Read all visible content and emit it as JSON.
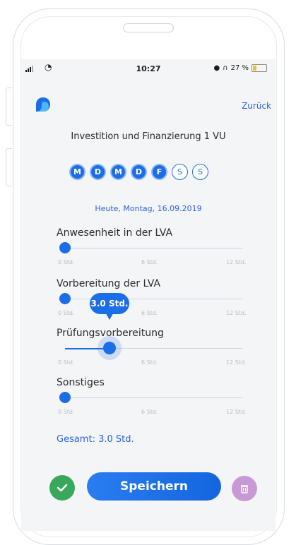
{
  "status_bar": {
    "time": "10:27",
    "battery": "27 %",
    "battery_level": 0.27
  },
  "header": {
    "back_label": "Zurück"
  },
  "course": {
    "title": "Investition und Finanzierung 1 VU"
  },
  "weekdays": [
    {
      "label": "M",
      "active": true
    },
    {
      "label": "D",
      "active": true
    },
    {
      "label": "M",
      "active": true
    },
    {
      "label": "D",
      "active": true
    },
    {
      "label": "F",
      "active": true
    },
    {
      "label": "S",
      "active": false
    },
    {
      "label": "S",
      "active": false
    }
  ],
  "date_text": "Heute, Montag, 16.09.2019",
  "scale_labels": {
    "min": "0 Std.",
    "mid": "6 Std.",
    "max": "12 Std."
  },
  "sliders": [
    {
      "label": "Anwesenheit in der LVA",
      "value": 0
    },
    {
      "label": "Vorbereitung der LVA",
      "value": 0
    },
    {
      "label": "Prüfungsvorbereitung",
      "value": 3.0,
      "bubble": "3.0 Std."
    },
    {
      "label": "Sonstiges",
      "value": 0
    }
  ],
  "total": "Gesamt: 3.0 Std.",
  "actions": {
    "save_label": "Speichern"
  },
  "colors": {
    "accent": "#1b6ee8",
    "confirm": "#3aa85a",
    "delete": "#c79ad6"
  }
}
